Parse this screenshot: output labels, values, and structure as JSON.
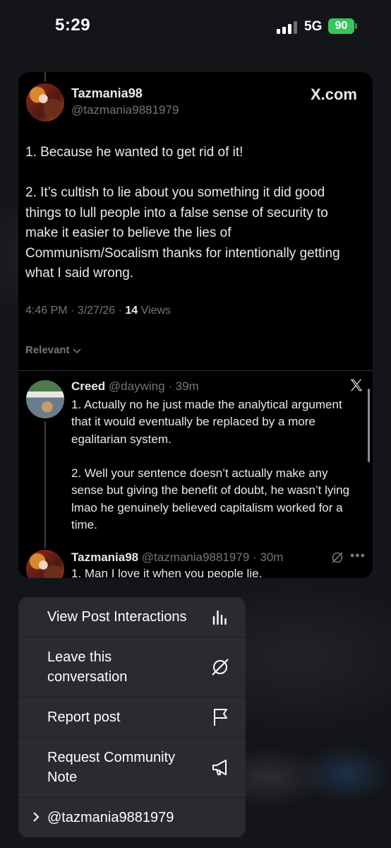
{
  "status_bar": {
    "time": "5:29",
    "network": "5G",
    "battery": "90",
    "battery_color": "#35c759"
  },
  "post": {
    "author_name": "Tazmania98",
    "author_handle": "@tazmania9881979",
    "site_label": "X.com",
    "paragraphs": [
      "1. Because he wanted to get rid of it!",
      "2. It’s cultish to lie about you something it did good things to lull people into a false sense of security to make it easier to believe the lies of Communism/Socalism thanks for intentionally getting what I said wrong."
    ],
    "timestamp": "4:46 PM · 3/27/26 · ",
    "views_count": "14",
    "views_label": " Views",
    "sort_label": "Relevant"
  },
  "replies": [
    {
      "name": "Creed",
      "handle_time": " @daywing · 39m",
      "paragraphs": [
        "1. Actually no he just made the analytical argument that it would eventually be replaced by a more egalitarian system.",
        "2. Well your sentence doesn’t actually make any sense but giving the benefit of doubt, he wasn’t lying lmao he genuinely believed capitalism worked for a time."
      ]
    },
    {
      "name": "Tazmania98",
      "handle_time": " @tazmania9881979 · 30m",
      "text": "1. Man I love it when you people lie."
    }
  ],
  "menu": {
    "items": [
      {
        "label": "View Post Interactions",
        "icon": "bar-chart-icon"
      },
      {
        "label": "Leave this conversation",
        "icon": "mute-conversation-icon"
      },
      {
        "label": "Report post",
        "icon": "flag-icon"
      },
      {
        "label": "Request Community Note",
        "icon": "megaphone-icon"
      },
      {
        "label": "@tazmania9881979",
        "icon": "chevron-right-icon"
      }
    ]
  },
  "colors": {
    "background": "#000000",
    "text_primary": "#e7e9ea",
    "text_secondary": "#71767b",
    "menu_background": "#2a2b2f"
  }
}
